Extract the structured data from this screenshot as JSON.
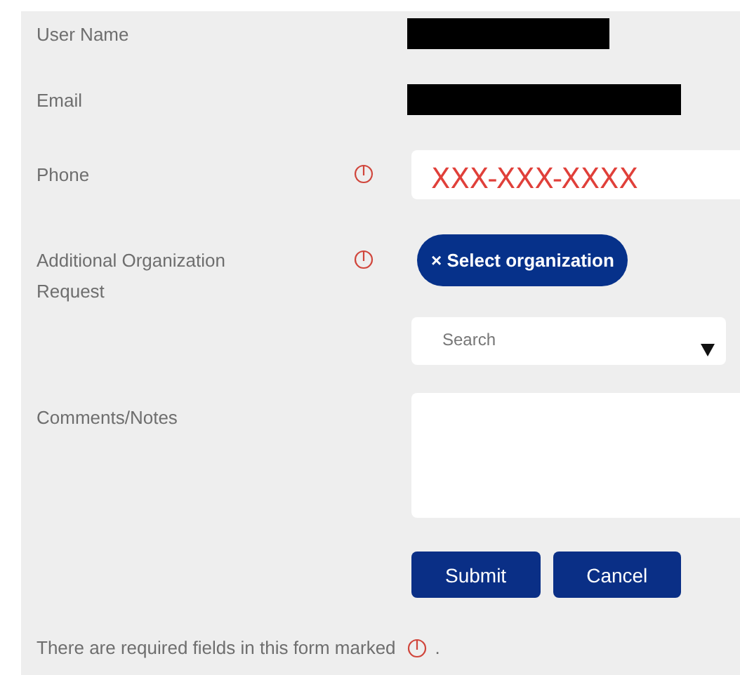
{
  "fields": [
    {
      "label": "User Name",
      "kind": "redacted",
      "required": false
    },
    {
      "label": "Email",
      "kind": "redacted",
      "required": false
    },
    {
      "label": "Phone",
      "kind": "text",
      "required": true,
      "value": "XXX-XXX-XXXX"
    },
    {
      "label": "Additional Organization Request",
      "kind": "tags",
      "required": true,
      "tags": [
        "× Select organization"
      ],
      "placeholder": "Search"
    },
    {
      "label": "Comments/Notes",
      "kind": "textarea",
      "required": false
    }
  ],
  "buttons": [
    "Submit",
    "Cancel"
  ],
  "footer": {
    "text": "There are required fields in this form marked",
    "end": "."
  }
}
